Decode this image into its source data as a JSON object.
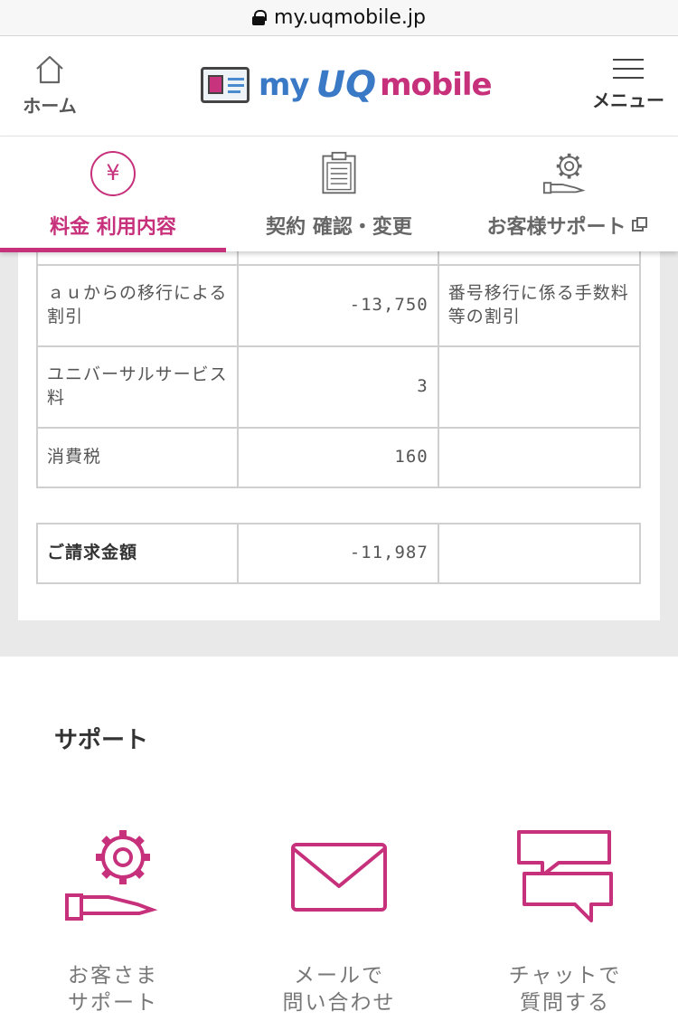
{
  "browser": {
    "url": "my.uqmobile.jp"
  },
  "header": {
    "home_label": "ホーム",
    "logo": {
      "my": "my",
      "uq": "UQ",
      "mobile": "mobile"
    },
    "menu_label": "メニュー"
  },
  "tabs": [
    {
      "label": "料金 利用内容",
      "icon": "yen-circle-icon",
      "active": true
    },
    {
      "label": "契約 確認・変更",
      "icon": "clipboard-icon",
      "active": false
    },
    {
      "label": "お客様サポート",
      "icon": "gear-hand-icon",
      "active": false,
      "external": true
    }
  ],
  "bill_table": {
    "rows": [
      {
        "item": "",
        "amount": "",
        "note": ""
      },
      {
        "item": "ａｕからの移行による割引",
        "amount": "-13,750",
        "note": "番号移行に係る手数料等の割引"
      },
      {
        "item": "ユニバーサルサービス料",
        "amount": "3",
        "note": ""
      },
      {
        "item": "消費税",
        "amount": "160",
        "note": ""
      }
    ],
    "total": {
      "item": "ご請求金額",
      "amount": "-11,987",
      "note": ""
    }
  },
  "support": {
    "title": "サポート",
    "items": [
      {
        "line1": "お客さま",
        "line2": "サポート",
        "icon": "gear-hand-icon"
      },
      {
        "line1": "メールで",
        "line2": "問い合わせ",
        "icon": "mail-icon"
      },
      {
        "line1": "チャットで",
        "line2": "質問する",
        "icon": "chat-icon"
      }
    ]
  },
  "colors": {
    "accent": "#c7307b",
    "brand_blue": "#3a79c6",
    "bg_gray": "#e9e9e9"
  }
}
